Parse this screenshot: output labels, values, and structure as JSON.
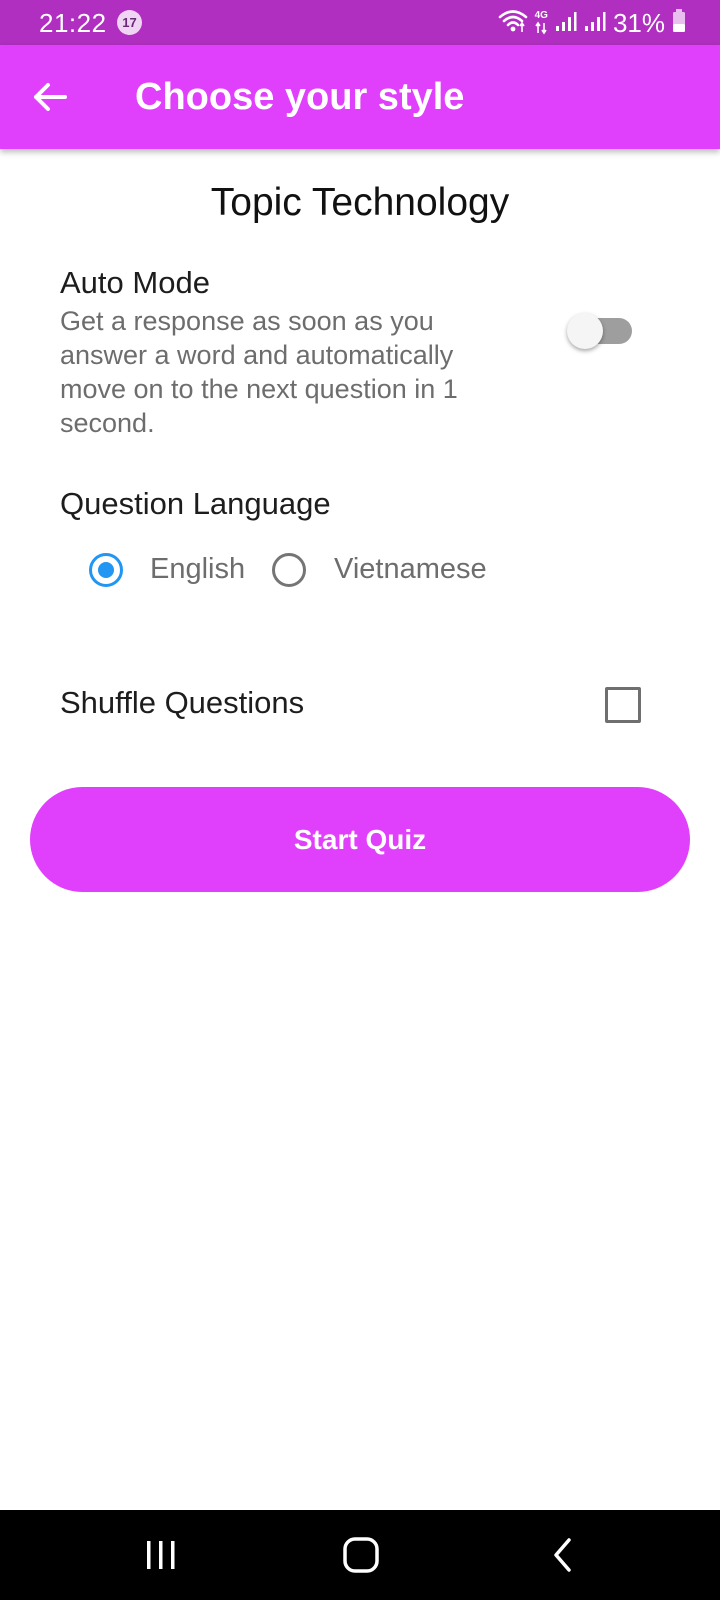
{
  "status_bar": {
    "time": "21:22",
    "notification_count": "17",
    "network_type_top": "4G",
    "battery_percent": "31%",
    "icons": [
      "wifi-icon",
      "signal-icon",
      "signal-icon",
      "battery-icon"
    ]
  },
  "app_bar": {
    "title": "Choose your style",
    "back_icon": "arrow-left-icon",
    "color": "#e040fb"
  },
  "content": {
    "topic_title": "Topic Technology",
    "auto_mode": {
      "title": "Auto Mode",
      "description": "Get a response as soon as you answer a word and automatically move on to the next question in 1 second.",
      "enabled": false
    },
    "question_language": {
      "title": "Question Language",
      "options": [
        "English",
        "Vietnamese"
      ],
      "selected": "English",
      "selected_color": "#2196f3"
    },
    "shuffle": {
      "title": "Shuffle Questions",
      "checked": false
    },
    "start_button": {
      "label": "Start Quiz"
    }
  },
  "nav_bar": {
    "icons": [
      "recent-apps-icon",
      "home-icon",
      "back-icon"
    ]
  }
}
